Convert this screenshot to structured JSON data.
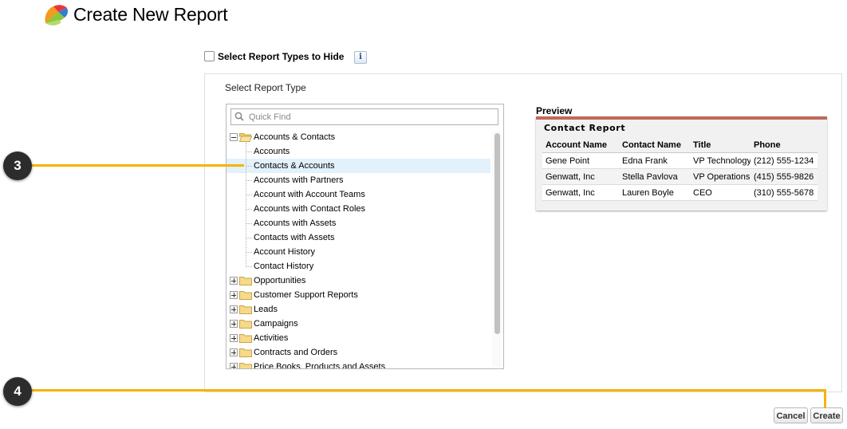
{
  "header": {
    "title": "Create New Report"
  },
  "hide_types": {
    "label": "Select Report Types to Hide",
    "info_glyph": "i",
    "checked": false
  },
  "selector": {
    "label": "Select Report Type",
    "quick_find_placeholder": "Quick Find",
    "tree": [
      {
        "label": "Accounts & Contacts",
        "kind": "folder",
        "expanded": true
      },
      {
        "label": "Accounts",
        "kind": "item"
      },
      {
        "label": "Contacts & Accounts",
        "kind": "item",
        "selected": true
      },
      {
        "label": "Accounts with Partners",
        "kind": "item"
      },
      {
        "label": "Account with Account Teams",
        "kind": "item"
      },
      {
        "label": "Accounts with Contact Roles",
        "kind": "item"
      },
      {
        "label": "Accounts with Assets",
        "kind": "item"
      },
      {
        "label": "Contacts with Assets",
        "kind": "item"
      },
      {
        "label": "Account History",
        "kind": "item"
      },
      {
        "label": "Contact History",
        "kind": "item"
      },
      {
        "label": "Opportunities",
        "kind": "folder",
        "expanded": false
      },
      {
        "label": "Customer Support Reports",
        "kind": "folder",
        "expanded": false
      },
      {
        "label": "Leads",
        "kind": "folder",
        "expanded": false
      },
      {
        "label": "Campaigns",
        "kind": "folder",
        "expanded": false
      },
      {
        "label": "Activities",
        "kind": "folder",
        "expanded": false
      },
      {
        "label": "Contracts and Orders",
        "kind": "folder",
        "expanded": false
      },
      {
        "label": "Price Books, Products and Assets",
        "kind": "folder",
        "expanded": false
      }
    ]
  },
  "preview": {
    "heading": "Preview",
    "report_title": "Contact Report",
    "columns": [
      "Account  Name",
      "Contact Name",
      "Title",
      "Phone"
    ],
    "rows": [
      [
        "Gene Point",
        "Edna Frank",
        "VP Technology",
        "(212) 555-1234"
      ],
      [
        "Genwatt, Inc",
        "Stella Pavlova",
        "VP Operations",
        "(415) 555-9826"
      ],
      [
        "Genwatt, Inc",
        "Lauren Boyle",
        "CEO",
        "(310) 555-5678"
      ]
    ]
  },
  "callouts": {
    "step_a": "3",
    "step_b": "4"
  },
  "buttons": {
    "cancel": "Cancel",
    "create": "Create"
  },
  "colors": {
    "callout_line": "#f4b400",
    "preview_accent": "#c0695a",
    "selected_row": "#e3f1fb"
  }
}
